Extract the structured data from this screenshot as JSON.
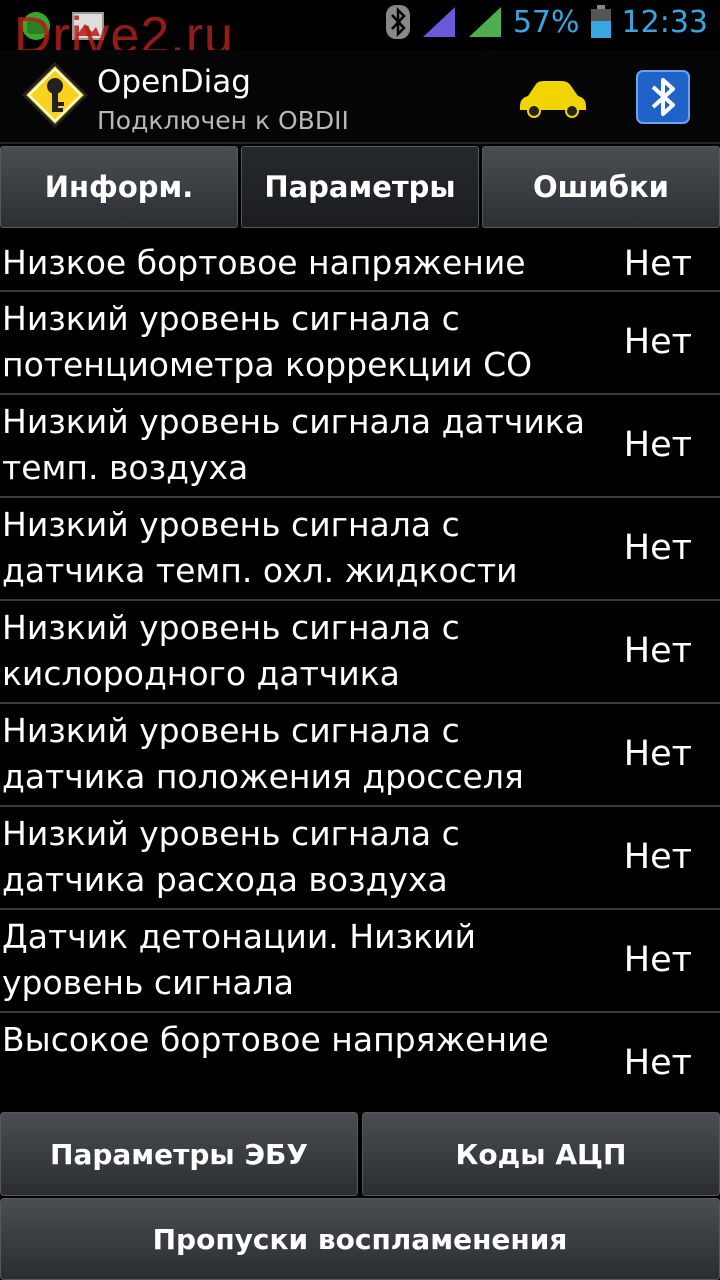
{
  "status_bar": {
    "watermark": "Drive2.ru",
    "battery_percent": "57%",
    "time": "12:33",
    "icons": [
      "android-icon",
      "image-icon",
      "bluetooth-icon",
      "signal-icon",
      "signal-icon",
      "battery-icon"
    ]
  },
  "action_bar": {
    "title": "OpenDiag",
    "subtitle": "Подключен к OBDII",
    "icons": [
      "app-key-icon",
      "car-icon",
      "bluetooth-elm-icon"
    ]
  },
  "tabs": [
    {
      "label": "Информ.",
      "active": false
    },
    {
      "label": "Параметры",
      "active": true
    },
    {
      "label": "Ошибки",
      "active": false
    }
  ],
  "list": {
    "rows": [
      {
        "label": "Низкое бортовое напряжение",
        "value": "Нет"
      },
      {
        "label": "Низкий уровень сигнала с потенциометра коррекции CO",
        "value": "Нет"
      },
      {
        "label": "Низкий уровень сигнала датчика темп. воздуха",
        "value": "Нет"
      },
      {
        "label": "Низкий уровень сигнала с датчика темп. охл. жидкости",
        "value": "Нет"
      },
      {
        "label": "Низкий уровень сигнала с кислородного датчика",
        "value": "Нет"
      },
      {
        "label": "Низкий уровень сигнала с датчика положения дросселя",
        "value": "Нет"
      },
      {
        "label": "Низкий уровень сигнала с датчика расхода воздуха",
        "value": "Нет"
      },
      {
        "label": "Датчик детонации. Низкий уровень сигнала",
        "value": "Нет"
      },
      {
        "label": "Высокое бортовое напряжение",
        "value": "Нет"
      }
    ]
  },
  "bottom_buttons": {
    "ecu_params": "Параметры ЭБУ",
    "adc_codes": "Коды АЦП",
    "misfires": "Пропуски воспламенения"
  },
  "colors": {
    "accent": "#36a7e0",
    "watermark": "#b0201c",
    "button_bg": "#3a3e42"
  }
}
